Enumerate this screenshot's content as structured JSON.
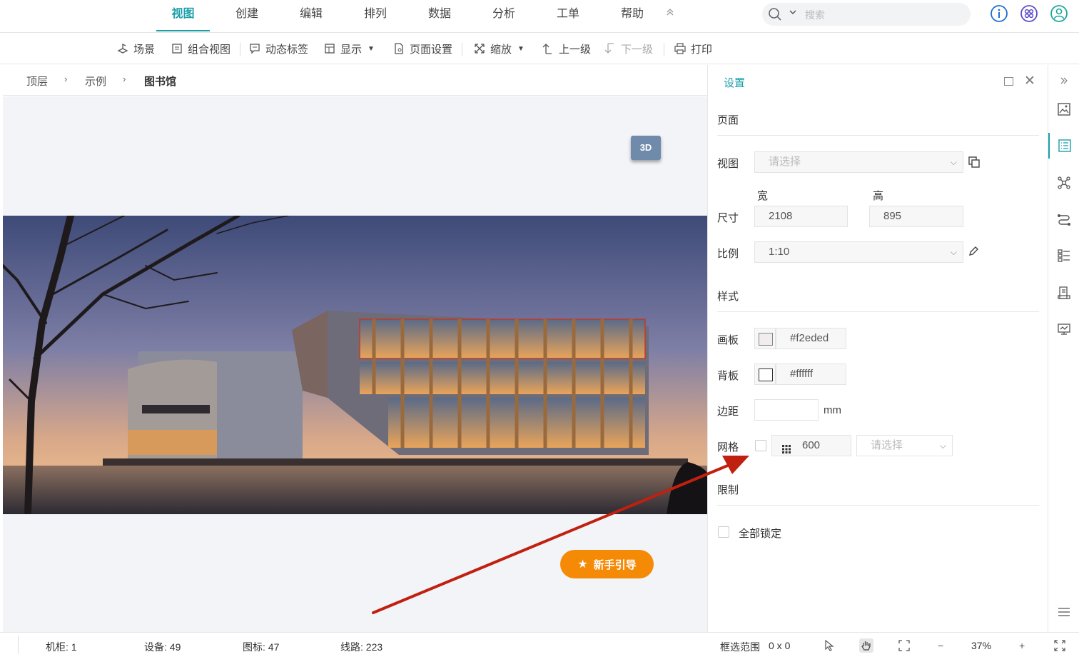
{
  "menu": {
    "tabs": [
      {
        "label": "视图",
        "active": true
      },
      {
        "label": "创建"
      },
      {
        "label": "编辑"
      },
      {
        "label": "排列"
      },
      {
        "label": "数据"
      },
      {
        "label": "分析"
      },
      {
        "label": "工单"
      },
      {
        "label": "帮助"
      }
    ],
    "search_placeholder": "搜索",
    "icons": [
      "info-icon",
      "app-grid-icon",
      "user-icon"
    ]
  },
  "toolbar": {
    "scene": "场景",
    "combo_view": "组合视图",
    "dynamic_tag": "动态标签",
    "display": "显示",
    "page_settings": "页面设置",
    "zoom": "缩放",
    "up_level": "上一级",
    "down_level": "下一级",
    "print": "打印"
  },
  "breadcrumb": {
    "items": [
      "顶层",
      "示例",
      "图书馆"
    ],
    "separator": "›"
  },
  "canvas": {
    "btn_3d": "3D",
    "guide": "新手引导",
    "accent_orange": "#f58a07",
    "annotation_arrow_color": "#c0200f"
  },
  "panel": {
    "title": "设置",
    "section_page": "页面",
    "view_label": "视图",
    "view_placeholder": "请选择",
    "width_label": "宽",
    "height_label": "高",
    "size_label": "尺寸",
    "width_value": "2108",
    "height_value": "895",
    "scale_label": "比例",
    "scale_value": "1:10",
    "section_style": "样式",
    "canvas_label": "画板",
    "canvas_color": "#f2eded",
    "backboard_label": "背板",
    "backboard_color": "#ffffff",
    "margin_label": "边距",
    "margin_value": "",
    "margin_unit": "mm",
    "grid_label": "网格",
    "grid_value": "600",
    "grid_placeholder": "请选择",
    "section_limit": "限制",
    "lock_all": "全部锁定"
  },
  "sidebar_icons": [
    "collapse-right-icon",
    "image-icon",
    "list-icon",
    "topology-icon",
    "route-icon",
    "tree-list-icon",
    "report-icon",
    "monitor-icon",
    "menu-icon"
  ],
  "status": {
    "cabinet": "机柜: 1",
    "device": "设备: 49",
    "icon_count": "图标: 47",
    "lines": "线路: 223",
    "select_range_label": "框选范围",
    "select_range_value": "0 x 0",
    "zoom": "37%",
    "zoom_out": "−",
    "zoom_in": "+"
  },
  "colors": {
    "accent": "#1a9fa8"
  }
}
